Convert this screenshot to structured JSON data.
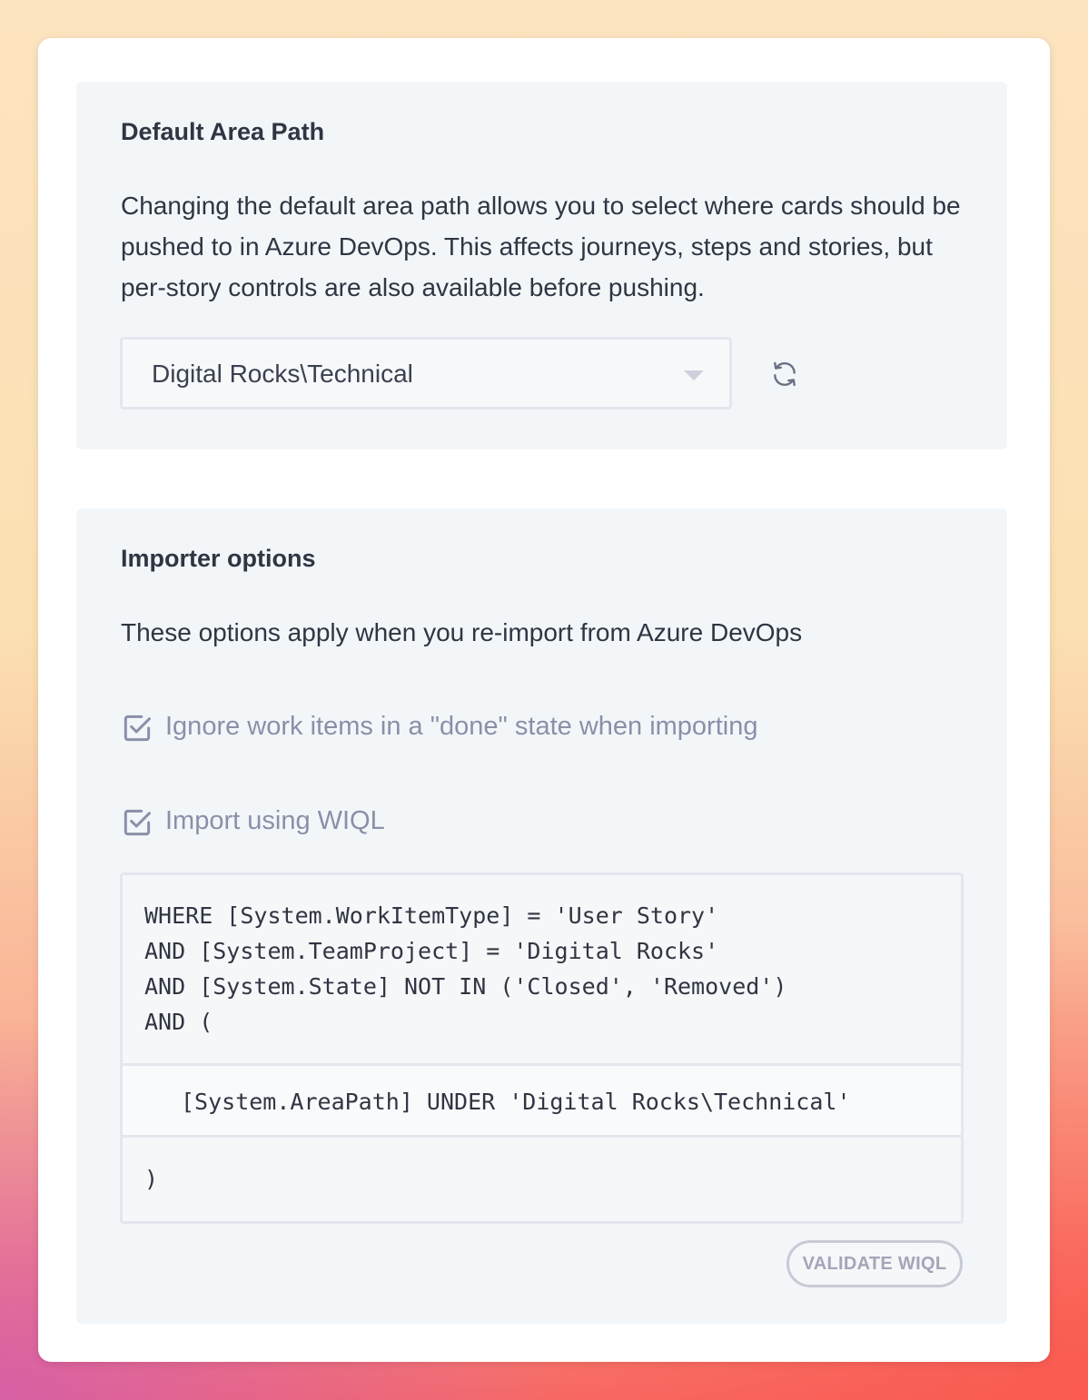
{
  "area_path": {
    "title": "Default Area Path",
    "description": "Changing the default area path allows you to select where cards should be pushed to in Azure DevOps. This affects journeys, steps and stories, but per-story controls are also available before pushing.",
    "selected_value": "Digital Rocks\\Technical",
    "refresh_icon": "refresh-icon"
  },
  "importer": {
    "title": "Importer options",
    "description": "These options apply when you re-import from Azure DevOps",
    "options": [
      {
        "label": "Ignore work items in a \"done\" state when importing",
        "checked": true
      },
      {
        "label": "Import using WIQL",
        "checked": true
      }
    ],
    "wiql": {
      "lines": [
        "WHERE [System.WorkItemType] = 'User Story'",
        "AND [System.TeamProject] = 'Digital Rocks'",
        "AND [System.State] NOT IN ('Closed', 'Removed')",
        "AND ("
      ],
      "area_clause": "[System.AreaPath] UNDER 'Digital Rocks\\Technical'",
      "closing": ")"
    },
    "validate_label": "VALIDATE WIQL"
  },
  "colors": {
    "section_bg": "#f3f6f9",
    "muted_text": "#8a90a8",
    "border": "#e4e6ef"
  }
}
